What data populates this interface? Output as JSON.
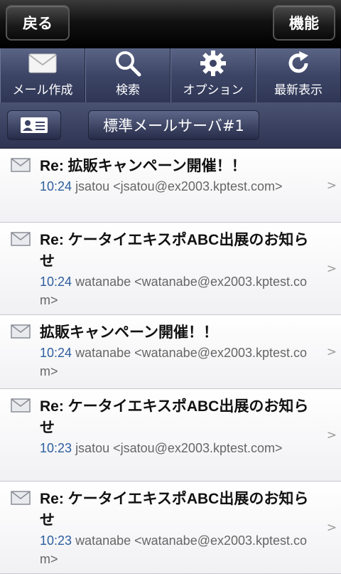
{
  "topbar": {
    "back_label": "戻る",
    "func_label": "機能"
  },
  "toolbar": {
    "items": [
      {
        "label": "メール作成",
        "icon": "envelope-icon"
      },
      {
        "label": "検索",
        "icon": "search-icon"
      },
      {
        "label": "オプション",
        "icon": "gear-icon"
      },
      {
        "label": "最新表示",
        "icon": "refresh-icon"
      }
    ]
  },
  "account": {
    "icon": "contact-card-icon",
    "server_label": "標準メールサーバ#1"
  },
  "mails": [
    {
      "subject": "Re: 拡販キャンペーン開催！！",
      "time": "10:24",
      "from": "jsatou <jsatou@ex2003.kptest.com>"
    },
    {
      "subject": "Re: ケータイエキスポABC出展のお知らせ",
      "time": "10:24",
      "from": "watanabe <watanabe@ex2003.kptest.com>"
    },
    {
      "subject": "拡販キャンペーン開催！！",
      "time": "10:24",
      "from": "watanabe <watanabe@ex2003.kptest.com>"
    },
    {
      "subject": "Re: ケータイエキスポABC出展のお知らせ",
      "time": "10:23",
      "from": "jsatou <jsatou@ex2003.kptest.com>"
    },
    {
      "subject": "Re: ケータイエキスポABC出展のお知らせ",
      "time": "10:23",
      "from": "watanabe <watanabe@ex2003.kptest.com>"
    }
  ],
  "row_chevron": ">"
}
